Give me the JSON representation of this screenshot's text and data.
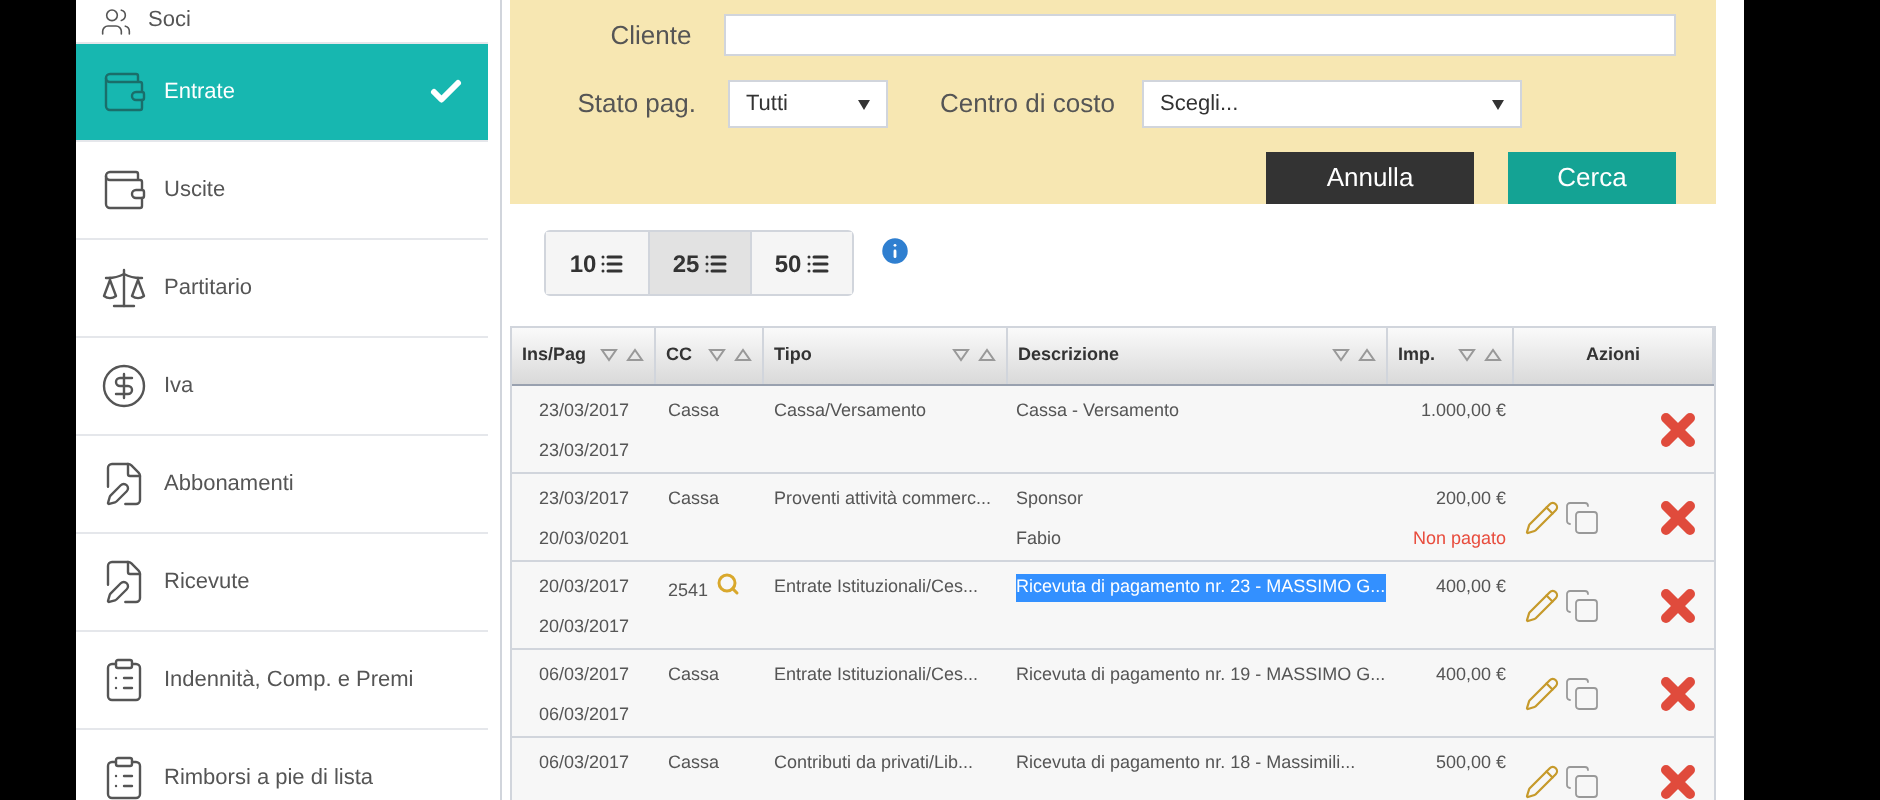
{
  "sidebar": {
    "items": [
      {
        "label": "Soci",
        "selected": false
      },
      {
        "label": "Entrate",
        "selected": true
      },
      {
        "label": "Uscite",
        "selected": false
      },
      {
        "label": "Partitario",
        "selected": false
      },
      {
        "label": "Iva",
        "selected": false
      },
      {
        "label": "Abbonamenti",
        "selected": false
      },
      {
        "label": "Ricevute",
        "selected": false
      },
      {
        "label": "Indennità, Comp. e Premi",
        "selected": false
      },
      {
        "label": "Rimborsi a pie di lista",
        "selected": false
      }
    ]
  },
  "filters": {
    "cliente": {
      "label": "Cliente"
    },
    "stato": {
      "label": "Stato pag.",
      "value": "Tutti"
    },
    "centro": {
      "label": "Centro di costo",
      "value": "Scegli..."
    },
    "buttons": [
      {
        "label": "Annulla",
        "kind": "cancel"
      },
      {
        "label": "Cerca",
        "kind": "primary"
      }
    ]
  },
  "page_sizes": [
    {
      "label": "10",
      "selected": false
    },
    {
      "label": "25",
      "selected": true
    },
    {
      "label": "50",
      "selected": false
    }
  ],
  "table": {
    "columns": [
      {
        "label": "Ins/Pag",
        "sortable": true
      },
      {
        "label": "CC",
        "sortable": true
      },
      {
        "label": "Tipo",
        "sortable": true
      },
      {
        "label": "Descrizione",
        "sortable": true
      },
      {
        "label": "Imp.",
        "sortable": true
      },
      {
        "label": "Azioni",
        "sortable": false
      }
    ],
    "rows": [
      {
        "ins": "23/03/2017",
        "pag": "23/03/2017",
        "cc": "Cassa",
        "cc_lookup": false,
        "tipo": "Cassa/Versamento",
        "descrizione": [
          "Cassa - Versamento"
        ],
        "importo": "1.000,00 €",
        "editable": false,
        "highlighted": false
      },
      {
        "ins": "23/03/2017",
        "pag": "20/03/0201",
        "cc": "Cassa",
        "cc_lookup": false,
        "tipo": "Proventi attività commerc...",
        "descrizione": [
          "Sponsor",
          "Fabio"
        ],
        "importo": "200,00 €",
        "stato": "Non pagato",
        "editable": true,
        "highlighted": false
      },
      {
        "ins": "20/03/2017",
        "pag": "20/03/2017",
        "cc": "2541",
        "cc_lookup": true,
        "tipo": "Entrate Istituzionali/Ces...",
        "descrizione": [
          "Ricevuta di pagamento nr. 23 - MASSIMO G..."
        ],
        "importo": "400,00 €",
        "editable": true,
        "highlighted": true
      },
      {
        "ins": "06/03/2017",
        "pag": "06/03/2017",
        "cc": "Cassa",
        "cc_lookup": false,
        "tipo": "Entrate Istituzionali/Ces...",
        "descrizione": [
          "Ricevuta di pagamento nr. 19 - MASSIMO G..."
        ],
        "importo": "400,00 €",
        "editable": true,
        "highlighted": false
      },
      {
        "ins": "06/03/2017",
        "cc": "Cassa",
        "cc_lookup": false,
        "tipo": "Contributi da privati/Lib...",
        "descrizione": [
          "Ricevuta di pagamento nr. 18 - Massimili..."
        ],
        "importo": "500,00 €",
        "editable": true,
        "highlighted": false
      }
    ]
  }
}
